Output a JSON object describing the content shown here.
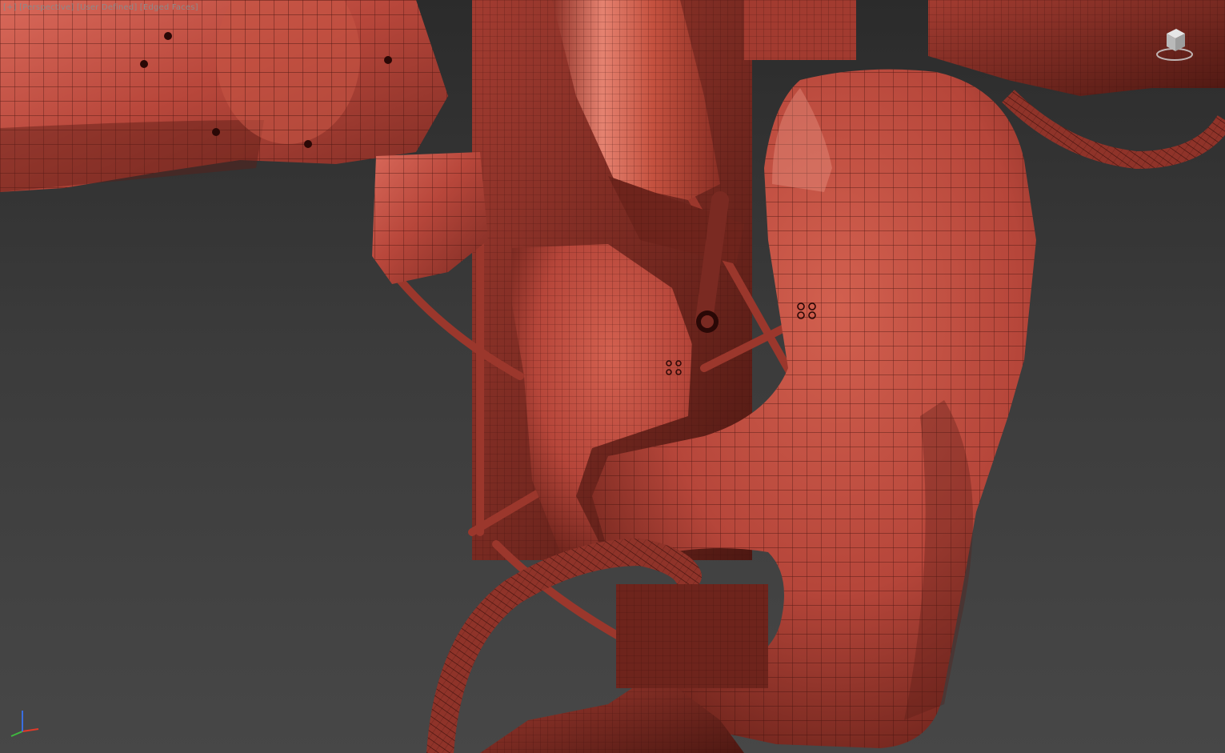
{
  "viewport": {
    "label": "[+] [Perspective] [User Defined] [Edged Faces]",
    "view_mode": "perspective",
    "shading": "edged-faces"
  },
  "model": {
    "subject": "robot-arm-joint-mesh",
    "surface_color": "#b8473b",
    "highlight_color": "#e07463",
    "shadow_color": "#5a1d17",
    "wire_color": "#3a0e0b"
  },
  "background": {
    "top_color": "#2b2b2b",
    "bottom_color": "#474747"
  },
  "view_cube": {
    "icon": "view-cube-icon"
  },
  "axis_tripod": {
    "icon": "axis-tripod-icon",
    "x_color": "#e03a2a",
    "y_color": "#3fb83f",
    "z_color": "#3a6ee0"
  }
}
